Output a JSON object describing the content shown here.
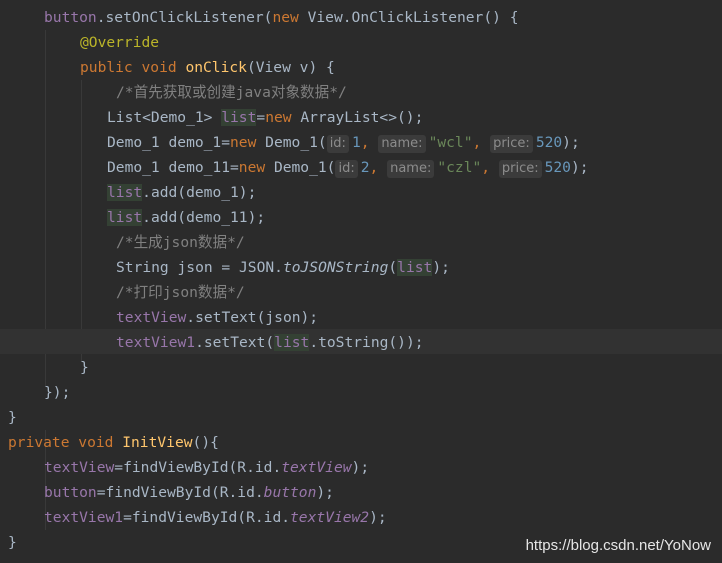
{
  "code": {
    "l1": {
      "a": "button",
      "b": ".setOnClickListener(",
      "c": "new ",
      "d": "View.OnClickListener",
      "e": "() {"
    },
    "l2": {
      "a": "@Override"
    },
    "l3": {
      "a": "public void ",
      "b": "onClick",
      "c": "(View v) {"
    },
    "l4": {
      "a": "/*首先获取或创建java对象数据*/"
    },
    "l5": {
      "a": "List<Demo_1> ",
      "b": "list",
      "c": "=",
      "d": "new ",
      "e": "ArrayList<>();"
    },
    "l6": {
      "a": "Demo_1 demo_1=",
      "b": "new ",
      "c": "Demo_1(",
      "h1": "id:",
      "d": "1",
      "e": ", ",
      "h2": "name:",
      "f": "\"wcl\"",
      "g": ", ",
      "h3": "price:",
      "i": "520",
      "j": ");"
    },
    "l7": {
      "a": "Demo_1 demo_11=",
      "b": "new ",
      "c": "Demo_1(",
      "h1": "id:",
      "d": "2",
      "e": ", ",
      "h2": "name:",
      "f": "\"czl\"",
      "g": ", ",
      "h3": "price:",
      "i": "520",
      "j": ");"
    },
    "l8": {
      "a": "list",
      "b": ".add(demo_1);"
    },
    "l9": {
      "a": "list",
      "b": ".add(demo_11);"
    },
    "l10": {
      "a": "/*生成json数据*/"
    },
    "l11": {
      "a": "String json = JSON.",
      "b": "toJSONString",
      "c": "(",
      "d": "list",
      "e": ");"
    },
    "l12": {
      "a": "/*打印json数据*/"
    },
    "l13": {
      "a": "textView",
      "b": ".setText(json);"
    },
    "l14": {
      "a": "textView1",
      "b": ".setText(",
      "c": "list",
      "d": ".toString());"
    },
    "l15": {
      "a": "}"
    },
    "l16": {
      "a": "});"
    },
    "l17": {
      "a": "}"
    },
    "l18": {
      "a": "private void ",
      "b": "InitView",
      "c": "(){"
    },
    "l19": {
      "a": "textView",
      "b": "=findViewById(R.id.",
      "c": "textView",
      "d": ");"
    },
    "l20": {
      "a": "button",
      "b": "=findViewById(R.id.",
      "c": "button",
      "d": ");"
    },
    "l21": {
      "a": "textView1",
      "b": "=findViewById(R.id.",
      "c": "textView2",
      "d": ");"
    },
    "l22": {
      "a": "}"
    }
  },
  "watermark": "https://blog.csdn.net/YoNow",
  "colors": {
    "background": "#2b2b2b",
    "keyword": "#cc7832",
    "method": "#ffc66d",
    "field": "#9876aa",
    "string": "#6a8759",
    "number": "#6897bb",
    "annotation": "#bbb529",
    "comment": "#808080",
    "text": "#a9b7c6"
  }
}
